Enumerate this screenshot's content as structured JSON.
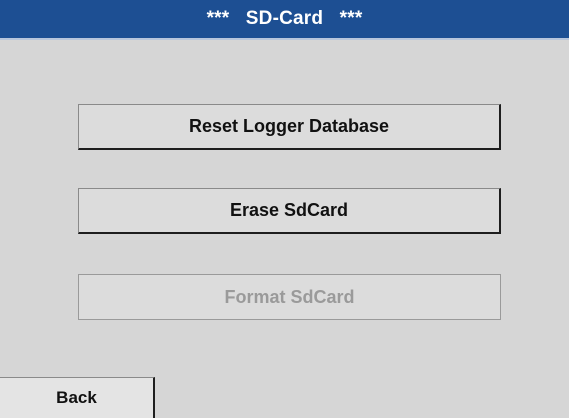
{
  "header": {
    "title": "***   SD-Card   ***"
  },
  "buttons": {
    "reset_logger_database": "Reset Logger Database",
    "erase_sdcard": "Erase SdCard",
    "format_sdcard": "Format SdCard"
  },
  "footer": {
    "back_label": "Back"
  },
  "colors": {
    "title_bar": "#1d4f93",
    "background": "#d6d6d6",
    "disabled_text": "#9a9a9a"
  }
}
